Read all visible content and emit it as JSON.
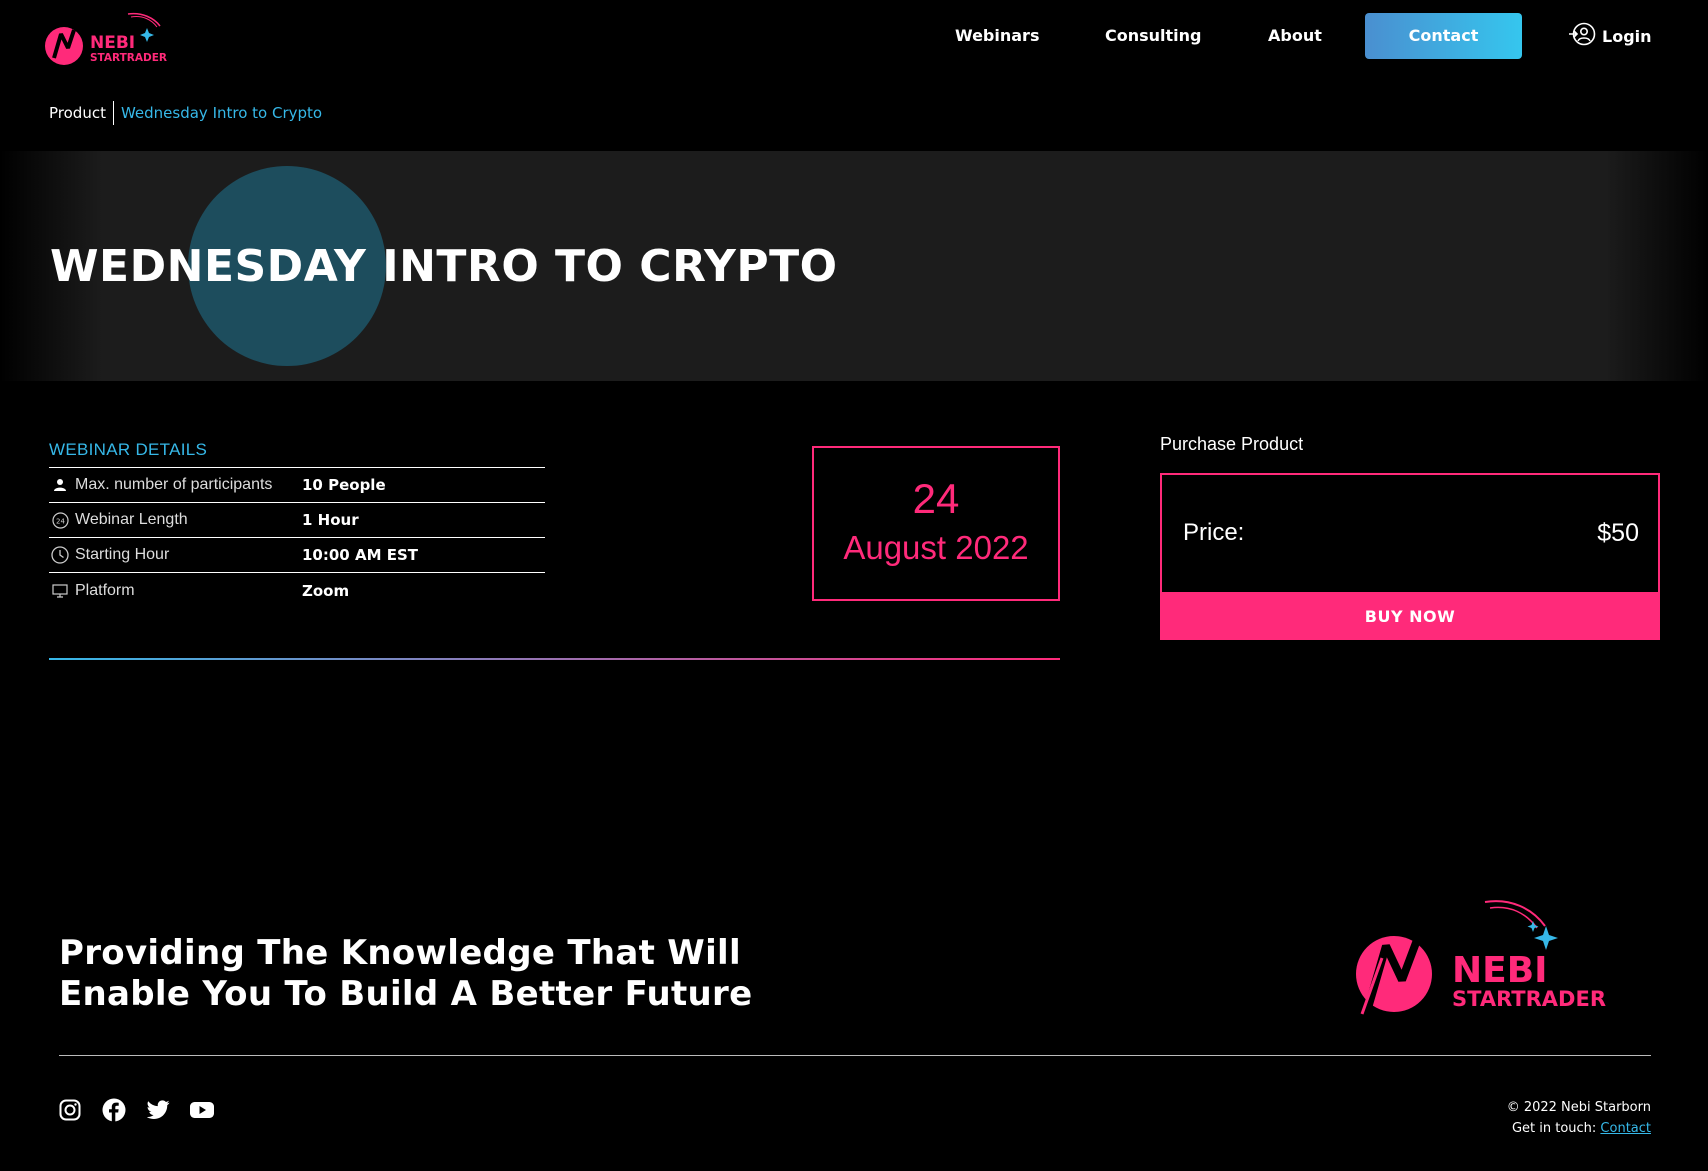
{
  "header": {
    "brand": {
      "line1": "NEBI",
      "line2": "STARTRADER"
    },
    "nav": {
      "webinars": "Webinars",
      "consulting": "Consulting",
      "about": "About",
      "contact": "Contact",
      "login": "Login"
    }
  },
  "breadcrumb": {
    "root": "Product",
    "current": "Wednesday Intro to Crypto"
  },
  "hero": {
    "title": "WEDNESDAY INTRO TO CRYPTO"
  },
  "details": {
    "title": "WEBINAR DETAILS",
    "rows": [
      {
        "icon": "person-icon",
        "label": "Max. number of participants",
        "value": "10 People"
      },
      {
        "icon": "24-hour-icon",
        "label": "Webinar Length",
        "value": "1 Hour"
      },
      {
        "icon": "clock-icon",
        "label": "Starting Hour",
        "value": "10:00 AM EST"
      },
      {
        "icon": "monitor-icon",
        "label": "Platform",
        "value": "Zoom"
      }
    ]
  },
  "date": {
    "day": "24",
    "month_year": "August 2022"
  },
  "purchase": {
    "title": "Purchase Product",
    "price_label": "Price:",
    "price_value": "$50",
    "buy_label": "BUY NOW"
  },
  "footer": {
    "tagline_line1": "Providing The Knowledge That Will",
    "tagline_line2": "Enable You To Build A Better Future",
    "copyright": "© 2022 Nebi Starborn",
    "get_in_touch": "Get in touch:",
    "contact_link": "Contact",
    "socials": [
      "instagram-icon",
      "facebook-icon",
      "twitter-icon",
      "youtube-icon"
    ]
  },
  "colors": {
    "accent_pink": "#ff2a7a",
    "accent_blue": "#36b8e8",
    "background": "#000000",
    "hero_bg": "#1c1c1c"
  }
}
